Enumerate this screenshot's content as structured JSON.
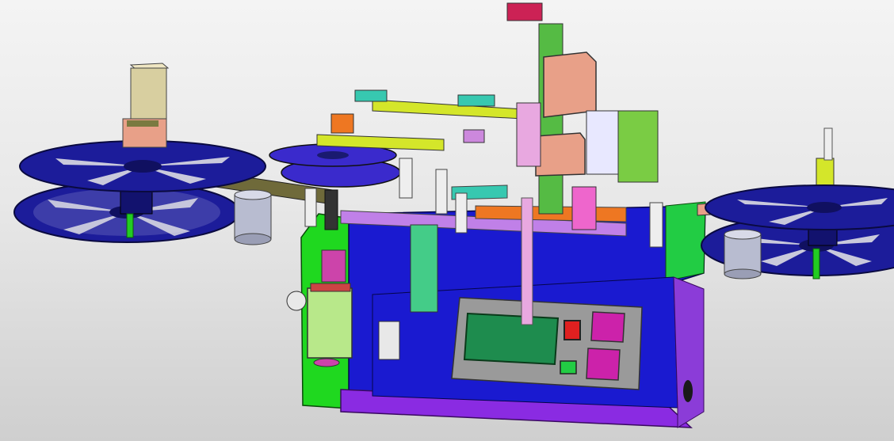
{
  "view": {
    "background_top": "#f4f4f4",
    "background_bottom": "#cfcfcf"
  },
  "colors": {
    "frame_blue": "#1a1ad0",
    "reel_blue": "#1c1c9a",
    "base_purple": "#8a2be2",
    "side_green": "#1fd81f",
    "yellow_green": "#d4e62a",
    "beige": "#d8cfa0",
    "salmon": "#e8a088",
    "magenta": "#cc22aa",
    "display_green": "#1e8c4e",
    "panel_grey": "#9a9a9a",
    "red_switch": "#e02020",
    "teal": "#37c8b0",
    "pink": "#e8a8e0",
    "orange": "#ee7722"
  }
}
